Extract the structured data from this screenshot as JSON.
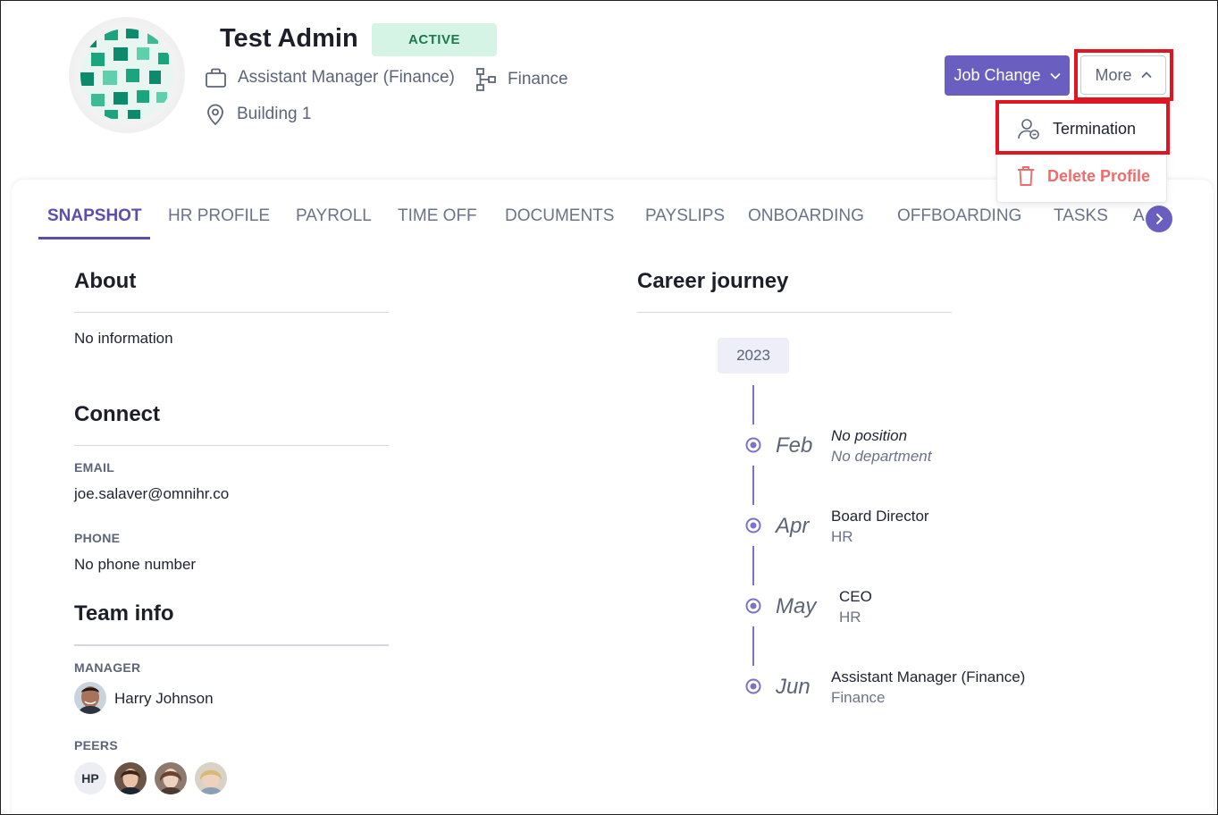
{
  "profile": {
    "name": "Test Admin",
    "status": "ACTIVE",
    "position": "Assistant Manager (Finance)",
    "department": "Finance",
    "location": "Building 1"
  },
  "actions": {
    "job_change": "Job Change",
    "more": "More",
    "menu": {
      "termination": "Termination",
      "delete_profile": "Delete Profile"
    }
  },
  "tabs": [
    "SNAPSHOT",
    "HR PROFILE",
    "PAYROLL",
    "TIME OFF",
    "DOCUMENTS",
    "PAYSLIPS",
    "ONBOARDING",
    "OFFBOARDING",
    "TASKS",
    "A"
  ],
  "about": {
    "title": "About",
    "text": "No information"
  },
  "connect": {
    "title": "Connect",
    "email_label": "EMAIL",
    "email": "joe.salaver@omnihr.co",
    "phone_label": "PHONE",
    "phone": "No phone number"
  },
  "team": {
    "title": "Team info",
    "manager_label": "MANAGER",
    "manager": "Harry Johnson",
    "peers_label": "PEERS",
    "peer_initials": "HP"
  },
  "career": {
    "title": "Career journey",
    "year": "2023",
    "entries": [
      {
        "month": "Feb",
        "position": "No position",
        "department": "No department"
      },
      {
        "month": "Apr",
        "position": "Board Director",
        "department": "HR"
      },
      {
        "month": "May",
        "position": "CEO",
        "department": "HR"
      },
      {
        "month": "Jun",
        "position": "Assistant Manager (Finance)",
        "department": "Finance"
      }
    ]
  },
  "colors": {
    "accent": "#6a5fc0",
    "status_bg": "#d5f4e6",
    "status_text": "#1c7a4e",
    "danger": "#f06b6b",
    "highlight": "#e11521"
  }
}
